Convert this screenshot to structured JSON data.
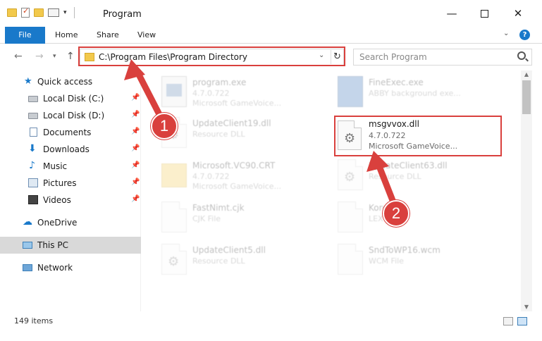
{
  "window": {
    "title": "Program",
    "min_symbol": "—",
    "close_symbol": "✕"
  },
  "ribbon": {
    "file": "File",
    "home": "Home",
    "share": "Share",
    "view": "View",
    "help": "?"
  },
  "nav": {
    "address": "C:\\Program Files\\Program Directory",
    "search_placeholder": "Search Program"
  },
  "sidebar": {
    "items": [
      {
        "label": "Quick access",
        "icon": "star-icon"
      },
      {
        "label": "Local Disk (C:)",
        "icon": "disk-icon"
      },
      {
        "label": "Local Disk (D:)",
        "icon": "disk-icon"
      },
      {
        "label": "Documents",
        "icon": "documents-icon"
      },
      {
        "label": "Downloads",
        "icon": "download-icon"
      },
      {
        "label": "Music",
        "icon": "music-icon"
      },
      {
        "label": "Pictures",
        "icon": "pictures-icon"
      },
      {
        "label": "Videos",
        "icon": "videos-icon"
      },
      {
        "label": "OneDrive",
        "icon": "cloud-icon"
      },
      {
        "label": "This PC",
        "icon": "computer-icon"
      },
      {
        "label": "Network",
        "icon": "network-icon"
      }
    ]
  },
  "files": [
    {
      "name": "program.exe",
      "line1": "4.7.0.722",
      "line2": "Microsoft GameVoice..."
    },
    {
      "name": "FineExec.exe",
      "line1": "ABBY background exe...",
      "line2": ""
    },
    {
      "name": "UpdateClient19.dll",
      "line1": "Resource DLL",
      "line2": ""
    },
    {
      "name": "Microsoft.VC90.CRT",
      "line1": "4.7.0.722",
      "line2": "Microsoft GameVoice..."
    },
    {
      "name": "UpdateClient63.dll",
      "line1": "Resource DLL",
      "line2": ""
    },
    {
      "name": "FastNimt.cjk",
      "line1": "CJK File",
      "line2": ""
    },
    {
      "name": "Korean.lx",
      "line1": "LEX File",
      "line2": ""
    },
    {
      "name": "UpdateClient5.dll",
      "line1": "Resource DLL",
      "line2": ""
    },
    {
      "name": "SndToWP16.wcm",
      "line1": "WCM File",
      "line2": ""
    }
  ],
  "highlighted_file": {
    "name": "msgvvox.dll",
    "line1": "4.7.0.722",
    "line2": "Microsoft GameVoice..."
  },
  "callouts": {
    "one": "1",
    "two": "2"
  },
  "status": {
    "count": "149 items"
  },
  "colors": {
    "accent": "#1979ca",
    "highlight": "#d9403d"
  }
}
